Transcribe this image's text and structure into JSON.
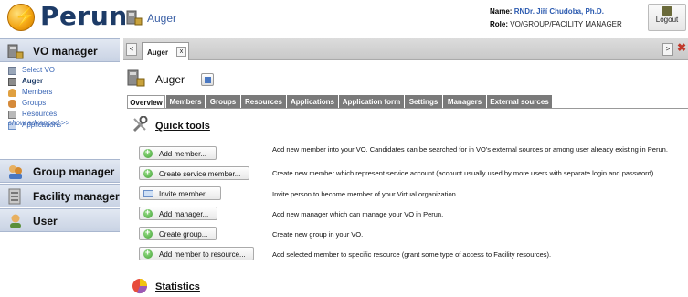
{
  "header": {
    "logo_text": "Perun",
    "context_title": "Auger",
    "name_label": "Name:",
    "name_value": "RNDr. Jiří Chudoba, Ph.D.",
    "role_label": "Role:",
    "role_value": "VO/GROUP/FACILITY MANAGER",
    "logout_label": "Logout"
  },
  "left_menu": {
    "vo_manager": "VO manager",
    "items": [
      {
        "label": "Select VO",
        "icon": "list-icon"
      },
      {
        "label": "Auger",
        "icon": "vo-icon"
      },
      {
        "label": "Members",
        "icon": "user-icon"
      },
      {
        "label": "Groups",
        "icon": "group-icon"
      },
      {
        "label": "Resources",
        "icon": "server-icon"
      },
      {
        "label": "Applications",
        "icon": "application-icon"
      }
    ],
    "show_advanced": "show advanced >>",
    "group_manager": "Group manager",
    "facility_manager": "Facility manager",
    "user": "User"
  },
  "tabbar": {
    "prev": "<",
    "tab_label": "Auger",
    "tab_close": "x",
    "next": ">"
  },
  "vo": {
    "name": "Auger"
  },
  "subtabs": [
    "Overview",
    "Members",
    "Groups",
    "Resources",
    "Applications",
    "Application form",
    "Settings",
    "Managers",
    "External sources"
  ],
  "quick_tools": {
    "title": "Quick tools",
    "actions": [
      {
        "label": "Add member...",
        "icon": "add-icon",
        "desc": "Add new member into your VO. Candidates can be searched for in VO's external sources or among user already existing in Perun."
      },
      {
        "label": "Create service member...",
        "icon": "add-icon",
        "desc": "Create new member which represent service account (account usually used by more users with separate login and password)."
      },
      {
        "label": "Invite member...",
        "icon": "invite-icon",
        "desc": "Invite person to become member of your Virtual organization."
      },
      {
        "label": "Add manager...",
        "icon": "add-icon",
        "desc": "Add new manager which can manage your VO in Perun."
      },
      {
        "label": "Create group...",
        "icon": "add-icon",
        "desc": "Create new group in your VO."
      },
      {
        "label": "Add member to resource...",
        "icon": "add-icon",
        "desc": "Add selected member to specific resource (grant some type of access to Facility resources)."
      }
    ]
  },
  "statistics": {
    "title": "Statistics"
  }
}
